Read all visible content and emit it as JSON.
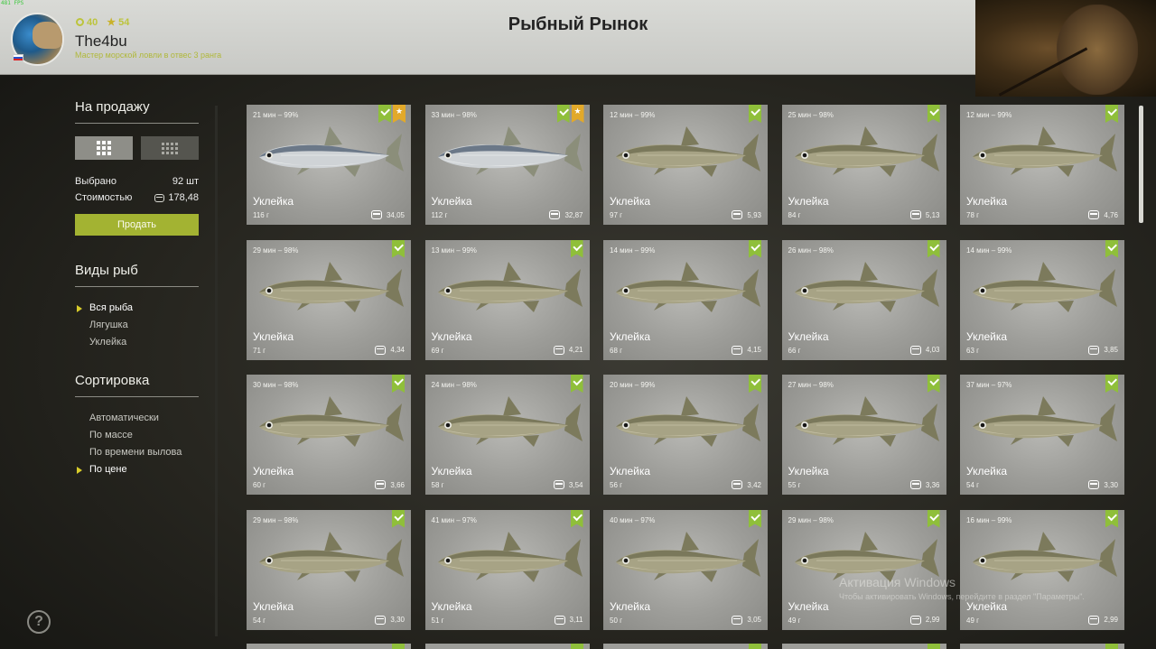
{
  "fps": "481 FPS",
  "player": {
    "level": "40",
    "stars": "54",
    "username": "The4bu",
    "rank": "Мастер морской ловли в отвес 3 ранга"
  },
  "page_title": "Рыбный Рынок",
  "sidebar": {
    "for_sale_title": "На продажу",
    "selected_label": "Выбрано",
    "selected_value": "92 шт",
    "cost_label": "Стоимостью",
    "cost_value": "178,48",
    "sell_button": "Продать",
    "species_title": "Виды рыб",
    "species": [
      {
        "label": "Вся рыба",
        "selected": true
      },
      {
        "label": "Лягушка",
        "selected": false
      },
      {
        "label": "Уклейка",
        "selected": false
      }
    ],
    "sort_title": "Сортировка",
    "sort_options": [
      {
        "label": "Автоматически",
        "selected": false
      },
      {
        "label": "По массе",
        "selected": false
      },
      {
        "label": "По времени вылова",
        "selected": false
      },
      {
        "label": "По цене",
        "selected": true
      }
    ]
  },
  "fish_cards": [
    {
      "time": "21 мин – 99%",
      "name": "Уклейка",
      "weight": "116 г",
      "price": "34,05",
      "star": true,
      "variant": "silver"
    },
    {
      "time": "33 мин – 98%",
      "name": "Уклейка",
      "weight": "112 г",
      "price": "32,87",
      "star": true,
      "variant": "silver"
    },
    {
      "time": "12 мин – 99%",
      "name": "Уклейка",
      "weight": "97 г",
      "price": "5,93",
      "star": false,
      "variant": "olive"
    },
    {
      "time": "25 мин – 98%",
      "name": "Уклейка",
      "weight": "84 г",
      "price": "5,13",
      "star": false,
      "variant": "olive"
    },
    {
      "time": "12 мин – 99%",
      "name": "Уклейка",
      "weight": "78 г",
      "price": "4,76",
      "star": false,
      "variant": "olive"
    },
    {
      "time": "29 мин – 98%",
      "name": "Уклейка",
      "weight": "71 г",
      "price": "4,34",
      "star": false,
      "variant": "olive"
    },
    {
      "time": "13 мин – 99%",
      "name": "Уклейка",
      "weight": "69 г",
      "price": "4,21",
      "star": false,
      "variant": "olive"
    },
    {
      "time": "14 мин – 99%",
      "name": "Уклейка",
      "weight": "68 г",
      "price": "4,15",
      "star": false,
      "variant": "olive"
    },
    {
      "time": "26 мин – 98%",
      "name": "Уклейка",
      "weight": "66 г",
      "price": "4,03",
      "star": false,
      "variant": "olive"
    },
    {
      "time": "14 мин – 99%",
      "name": "Уклейка",
      "weight": "63 г",
      "price": "3,85",
      "star": false,
      "variant": "olive"
    },
    {
      "time": "30 мин – 98%",
      "name": "Уклейка",
      "weight": "60 г",
      "price": "3,66",
      "star": false,
      "variant": "olive"
    },
    {
      "time": "24 мин – 98%",
      "name": "Уклейка",
      "weight": "58 г",
      "price": "3,54",
      "star": false,
      "variant": "olive"
    },
    {
      "time": "20 мин – 99%",
      "name": "Уклейка",
      "weight": "56 г",
      "price": "3,42",
      "star": false,
      "variant": "olive"
    },
    {
      "time": "27 мин – 98%",
      "name": "Уклейка",
      "weight": "55 г",
      "price": "3,36",
      "star": false,
      "variant": "olive"
    },
    {
      "time": "37 мин – 97%",
      "name": "Уклейка",
      "weight": "54 г",
      "price": "3,30",
      "star": false,
      "variant": "olive"
    },
    {
      "time": "29 мин – 98%",
      "name": "Уклейка",
      "weight": "54 г",
      "price": "3,30",
      "star": false,
      "variant": "olive"
    },
    {
      "time": "41 мин – 97%",
      "name": "Уклейка",
      "weight": "51 г",
      "price": "3,11",
      "star": false,
      "variant": "olive"
    },
    {
      "time": "40 мин – 97%",
      "name": "Уклейка",
      "weight": "50 г",
      "price": "3,05",
      "star": false,
      "variant": "olive"
    },
    {
      "time": "29 мин – 98%",
      "name": "Уклейка",
      "weight": "49 г",
      "price": "2,99",
      "star": false,
      "variant": "olive"
    },
    {
      "time": "16 мин – 99%",
      "name": "Уклейка",
      "weight": "49 г",
      "price": "2,99",
      "star": false,
      "variant": "olive"
    }
  ],
  "windows_watermark": {
    "line1": "Активация Windows",
    "line2": "Чтобы активировать Windows, перейдите в раздел \"Параметры\"."
  },
  "colors": {
    "accent_green": "#a3b332",
    "check_badge": "#8fbf3a",
    "star_badge": "#e2a92a",
    "card_bg": "#9d9d99"
  }
}
